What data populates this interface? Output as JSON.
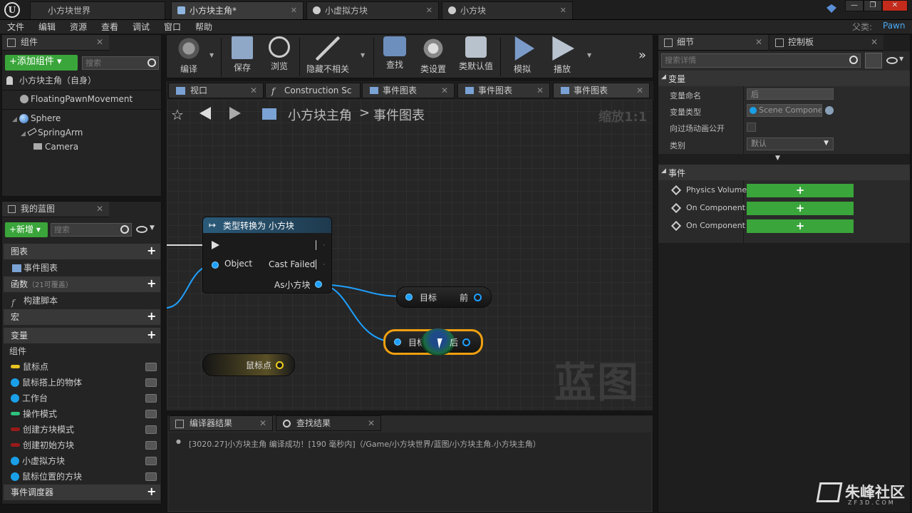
{
  "titlebar": {
    "logo": "U",
    "tabs": [
      {
        "label": "小方块世界"
      },
      {
        "label": "小方块主角*"
      },
      {
        "label": "小虚拟方块"
      },
      {
        "label": "小方块"
      }
    ],
    "parent_label": "父类:",
    "parent_value": "Pawn"
  },
  "menu": [
    "文件",
    "编辑",
    "资源",
    "查看",
    "调试",
    "窗口",
    "帮助"
  ],
  "components": {
    "title": "组件",
    "add_button": "+添加组件 ▾",
    "search_placeholder": "搜索",
    "self_item": "小方块主角（自身）",
    "items": [
      "FloatingPawnMovement",
      "Sphere",
      "SpringArm",
      "Camera"
    ]
  },
  "myblueprint": {
    "title": "我的蓝图",
    "new_button": "+新增 ▾",
    "search_placeholder": "搜索",
    "sections": {
      "graphs": "图表",
      "event_graph": "事件图表",
      "functions": "函数",
      "functions_hint": "（21可覆盖）",
      "construct": "构建脚本",
      "macros": "宏",
      "variables": "变量",
      "components": "组件",
      "dispatchers": "事件调度器"
    },
    "variables": [
      {
        "name": "鼠标点",
        "color": "#e8c320",
        "type": "pill"
      },
      {
        "name": "鼠标搭上的物体",
        "color": "#1aa0e8",
        "type": "dot"
      },
      {
        "name": "工作台",
        "color": "#1aa0e8",
        "type": "dot"
      },
      {
        "name": "操作模式",
        "color": "#2ec27e",
        "type": "pill"
      },
      {
        "name": "创建方块模式",
        "color": "#9a1a1a",
        "type": "pill"
      },
      {
        "name": "创建初始方块",
        "color": "#9a1a1a",
        "type": "pill"
      },
      {
        "name": "小虚拟方块",
        "color": "#1aa0e8",
        "type": "dot"
      },
      {
        "name": "鼠标位置的方块",
        "color": "#1aa0e8",
        "type": "dot"
      }
    ]
  },
  "toolbar": {
    "compile": "编译",
    "save": "保存",
    "browse": "浏览",
    "hide": "隐藏不相关",
    "find": "查找",
    "class_settings": "类设置",
    "class_defaults": "类默认值",
    "simulate": "模拟",
    "play": "播放"
  },
  "graphtabs": [
    "视口",
    "Construction Sc",
    "事件图表",
    "事件图表",
    "事件图表"
  ],
  "graph": {
    "breadcrumb_root": "小方块主角",
    "breadcrumb_sep": ">",
    "breadcrumb_leaf": "事件图表",
    "zoom": "缩放1:1",
    "watermark": "蓝图",
    "cast_node": {
      "title": "类型转换为 小方块",
      "in_object": "Object",
      "cast_failed": "Cast Failed",
      "as_output": "As小方块"
    },
    "node_front": {
      "left": "目标",
      "right": "前"
    },
    "node_back": {
      "left": "目标",
      "right": "后"
    },
    "node_mouse": "鼠标点"
  },
  "bottom": {
    "tab1": "编译器结果",
    "tab2": "查找结果",
    "log": "[3020.27]小方块主角 编译成功！[190 毫秒内]（/Game/小方块世界/蓝图/小方块主角.小方块主角）"
  },
  "details": {
    "tab": "细节",
    "tab2": "控制板",
    "search_placeholder": "搜索详情",
    "var_section": "变量",
    "var_name_label": "变量命名",
    "var_name_value": "后",
    "var_type_label": "变量类型",
    "var_type_value": "Scene Compone",
    "expose_label": "向过场动画公开",
    "category_label": "类别",
    "category_value": "默认",
    "events_section": "事件",
    "events": [
      "Physics Volume",
      "On Component A",
      "On Component E"
    ]
  },
  "footer_logo": "朱峰社区",
  "footer_logo_sub": "ZF3D.COM"
}
